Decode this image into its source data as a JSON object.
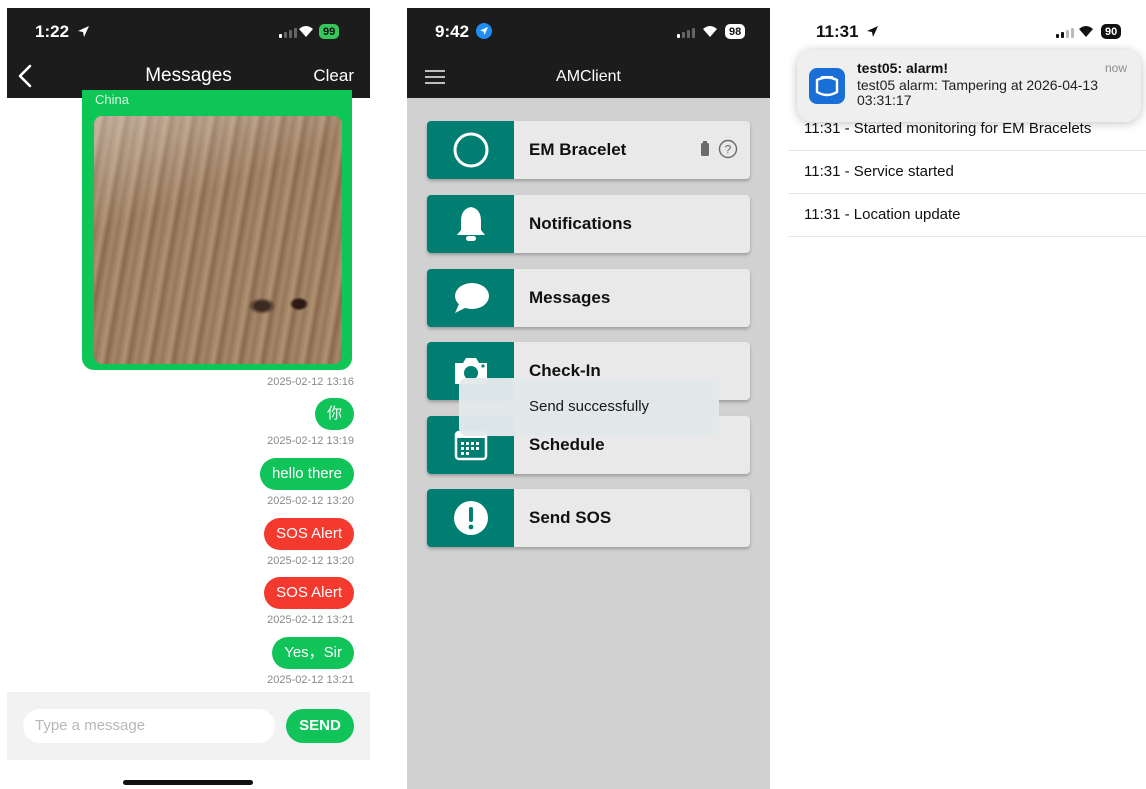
{
  "phone1": {
    "status": {
      "time": "1:22",
      "battery": "99"
    },
    "header": {
      "title": "Messages",
      "clear_label": "Clear"
    },
    "image_message": {
      "caption": "China",
      "timestamp": "2025-02-12 13:16"
    },
    "messages": [
      {
        "text": "你",
        "color": "green",
        "timestamp": "2025-02-12 13:19"
      },
      {
        "text": "hello there",
        "color": "green",
        "timestamp": "2025-02-12 13:20"
      },
      {
        "text": "SOS Alert",
        "color": "red",
        "timestamp": "2025-02-12 13:20"
      },
      {
        "text": "SOS Alert",
        "color": "red",
        "timestamp": "2025-02-12 13:21"
      },
      {
        "text": "Yes，Sir",
        "color": "green",
        "timestamp": "2025-02-12 13:21"
      }
    ],
    "composer": {
      "placeholder": "Type a message",
      "send_label": "SEND"
    }
  },
  "phone2": {
    "status": {
      "time": "9:42",
      "battery": "98"
    },
    "header": {
      "title": "AMClient"
    },
    "menu": [
      {
        "label": "EM Bracelet",
        "icon": "circle-icon"
      },
      {
        "label": "Notifications",
        "icon": "bell-icon"
      },
      {
        "label": "Messages",
        "icon": "chat-bubble-icon"
      },
      {
        "label": "Check-In",
        "icon": "camera-icon"
      },
      {
        "label": "Schedule",
        "icon": "calendar-icon"
      },
      {
        "label": "Send SOS",
        "icon": "exclamation-icon"
      }
    ],
    "toast": "Send successfully"
  },
  "phone3": {
    "status": {
      "time": "11:31",
      "battery": "90"
    },
    "notification": {
      "title": "test05: alarm!",
      "time": "now",
      "body": "test05 alarm: Tampering at 2026-04-13 03:31:17"
    },
    "log": [
      "11:31 - Started monitoring for EM Bracelets",
      "11:31 - Service started",
      "11:31 - Location update"
    ]
  },
  "colors": {
    "green": "#11c45a",
    "red": "#f4392f",
    "teal": "#007e72",
    "dark_header": "#1c1c1c"
  }
}
